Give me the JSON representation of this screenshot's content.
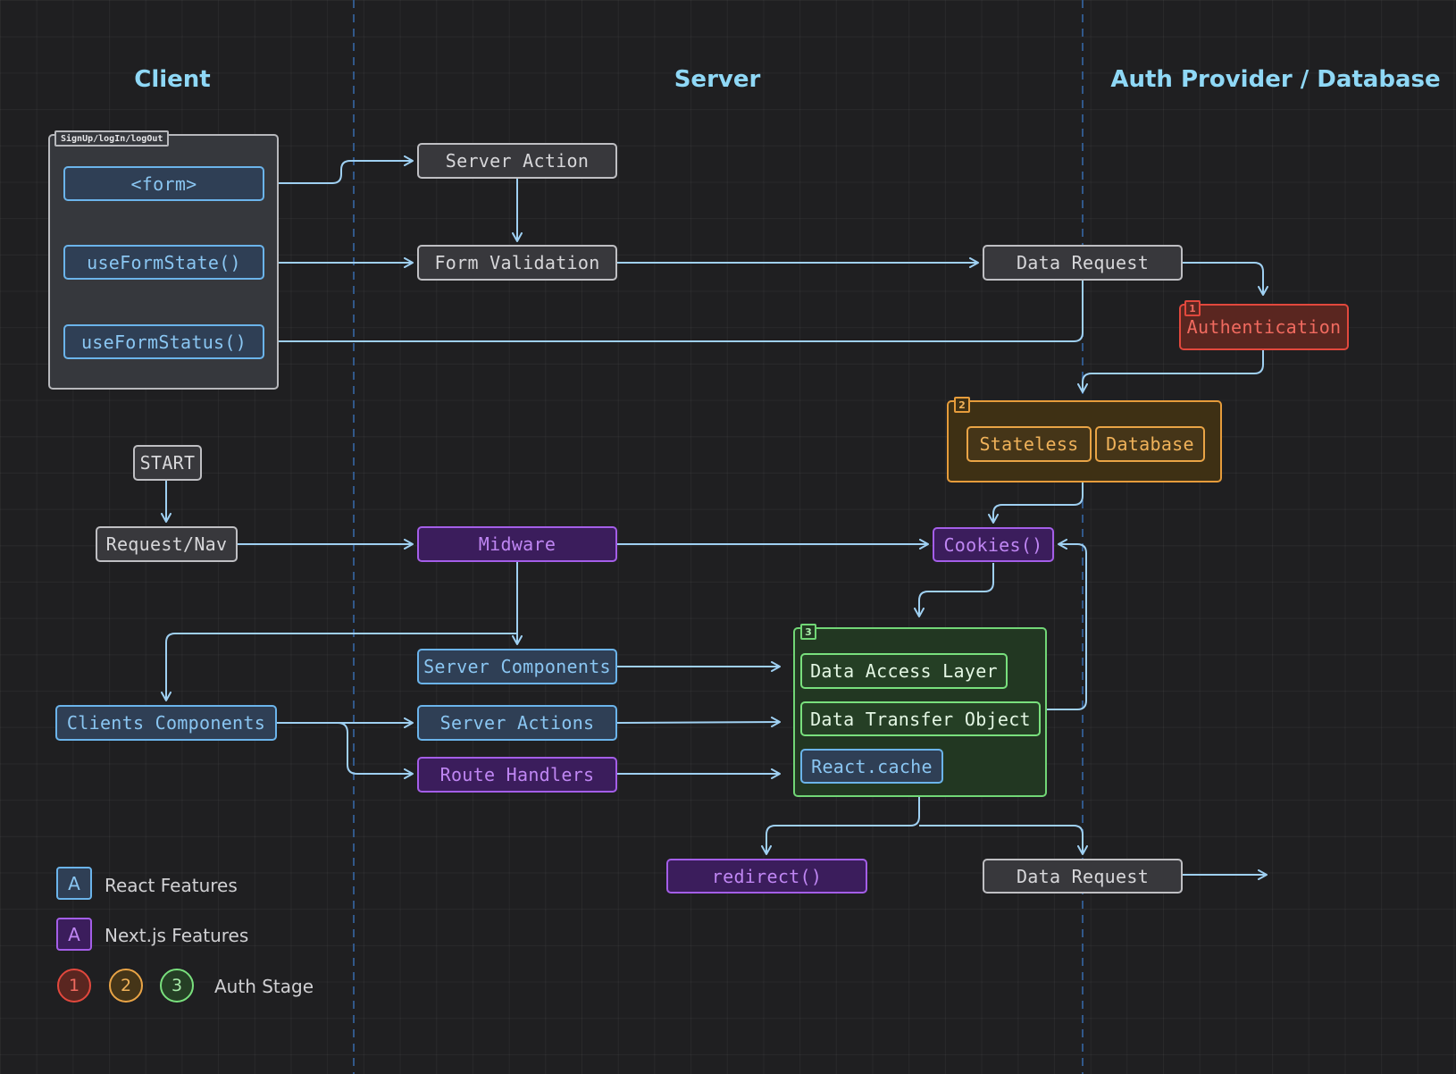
{
  "columns": {
    "client": "Client",
    "server": "Server",
    "provider": "Auth Provider / Database"
  },
  "client_group": {
    "tag": "SignUp/logIn/logOut",
    "form": "<form>",
    "use_form_state": "useFormState()",
    "use_form_status": "useFormStatus()"
  },
  "nodes": {
    "server_action": "Server Action",
    "form_validation": "Form Validation",
    "data_request_top": "Data Request",
    "authentication": "Authentication",
    "start": "START",
    "request_nav": "Request/Nav",
    "midware": "Midware",
    "cookies": "Cookies()",
    "server_components": "Server Components",
    "clients_components": "Clients Components",
    "server_actions": "Server Actions",
    "route_handlers": "Route Handlers",
    "redirect": "redirect()",
    "data_request_bottom": "Data Request"
  },
  "stage2": {
    "tag": "2",
    "stateless": "Stateless",
    "database": "Database"
  },
  "stage1": {
    "tag": "1"
  },
  "stage3": {
    "tag": "3",
    "data_access_layer": "Data Access Layer",
    "data_transfer_object": "Data Transfer Object",
    "react_cache": "React.cache"
  },
  "legend": {
    "react_mark": "A",
    "react_label": "React Features",
    "next_mark": "A",
    "next_label": "Next.js Features",
    "stages": [
      "1",
      "2",
      "3"
    ],
    "stage_label": "Auth Stage"
  },
  "colors": {
    "background": "#1f1f21",
    "wire": "#9fd0f2",
    "column_title": "#8fd8f6",
    "react": "#6bb4eb",
    "next": "#a45ee8",
    "stage1": "#e2483d",
    "stage2": "#e9a446",
    "stage3": "#79e07d"
  }
}
